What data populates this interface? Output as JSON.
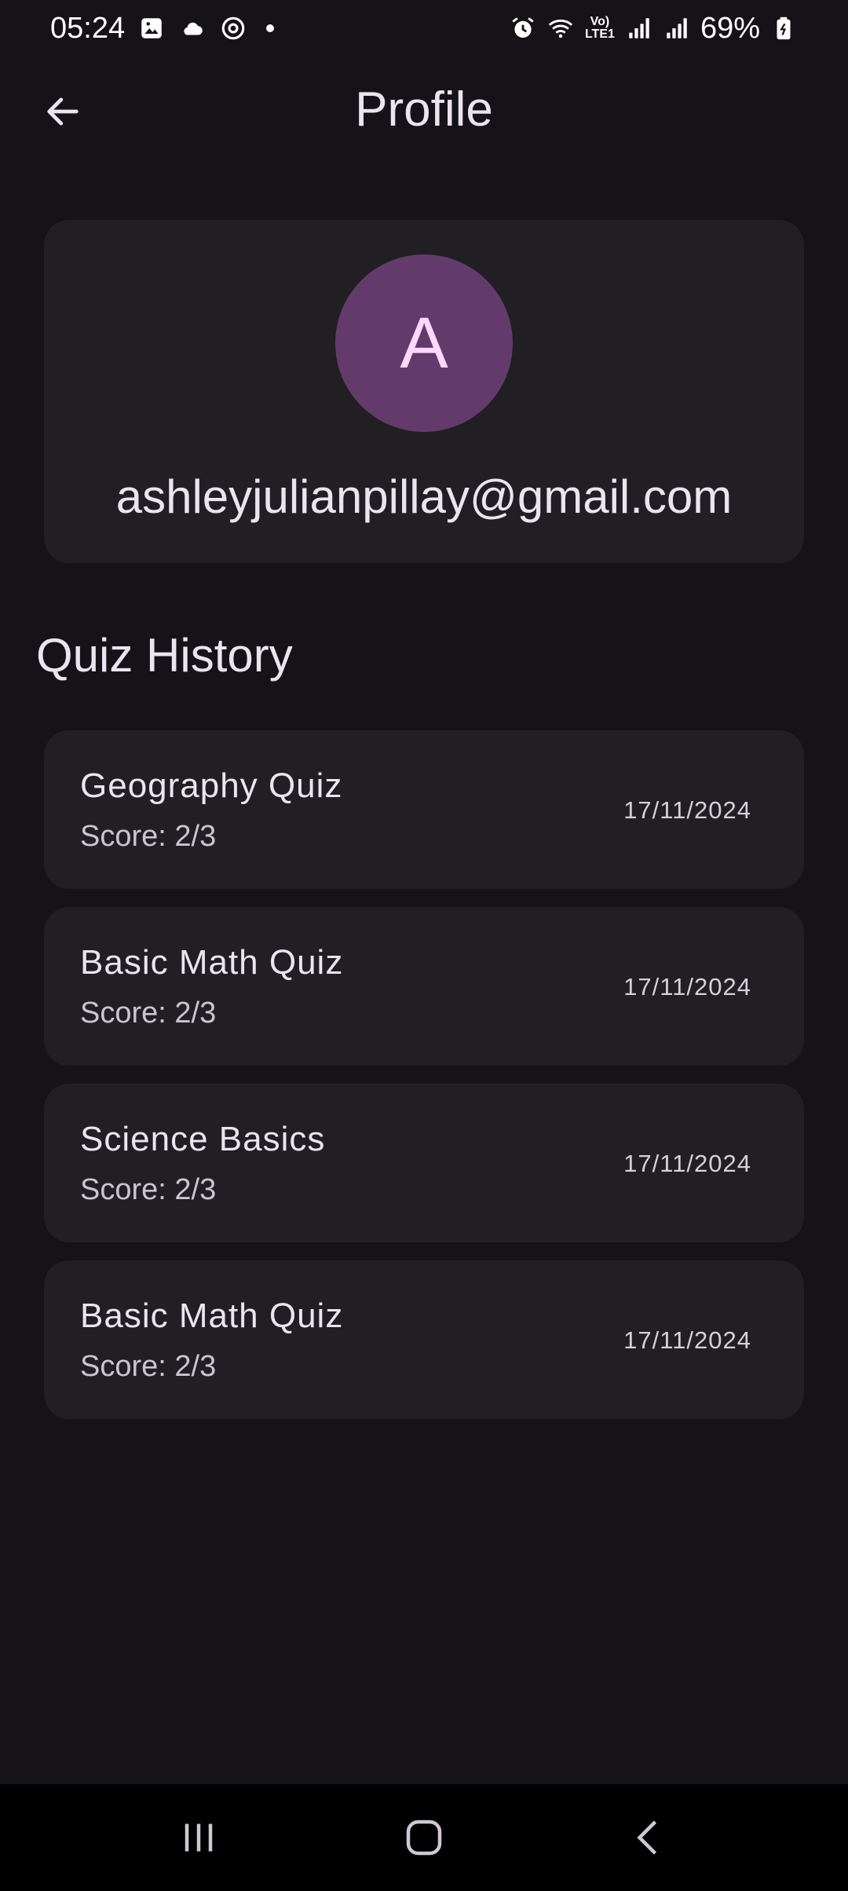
{
  "status_bar": {
    "time": "05:24",
    "battery": "69%",
    "network_label": "Vo) LTE1",
    "icons_left": [
      "gallery-icon",
      "cloud-icon",
      "sync-icon",
      "dot-icon"
    ],
    "icons_right": [
      "alarm-icon",
      "wifi-icon",
      "lte-icon",
      "signal-icon",
      "signal-icon",
      "battery-icon"
    ]
  },
  "app_bar": {
    "title": "Profile",
    "back_icon": "arrow-left-icon"
  },
  "profile": {
    "avatar_letter": "A",
    "email": "ashleyjulianpillay@gmail.com",
    "avatar_color": "#633b6b",
    "avatar_text_color": "#ffd8ff"
  },
  "quiz_history": {
    "title": "Quiz History",
    "items": [
      {
        "name": "Geography Quiz",
        "score": "Score: 2/3",
        "date": "17/11/2024"
      },
      {
        "name": "Basic Math Quiz",
        "score": "Score: 2/3",
        "date": "17/11/2024"
      },
      {
        "name": "Science Basics",
        "score": "Score: 2/3",
        "date": "17/11/2024"
      },
      {
        "name": "Basic Math Quiz",
        "score": "Score: 2/3",
        "date": "17/11/2024"
      }
    ]
  },
  "nav_bar": {
    "buttons": [
      "recents-icon",
      "home-icon",
      "back-icon"
    ]
  },
  "colors": {
    "background": "#151218",
    "card": "#211e24",
    "text": "#ece4ee"
  }
}
